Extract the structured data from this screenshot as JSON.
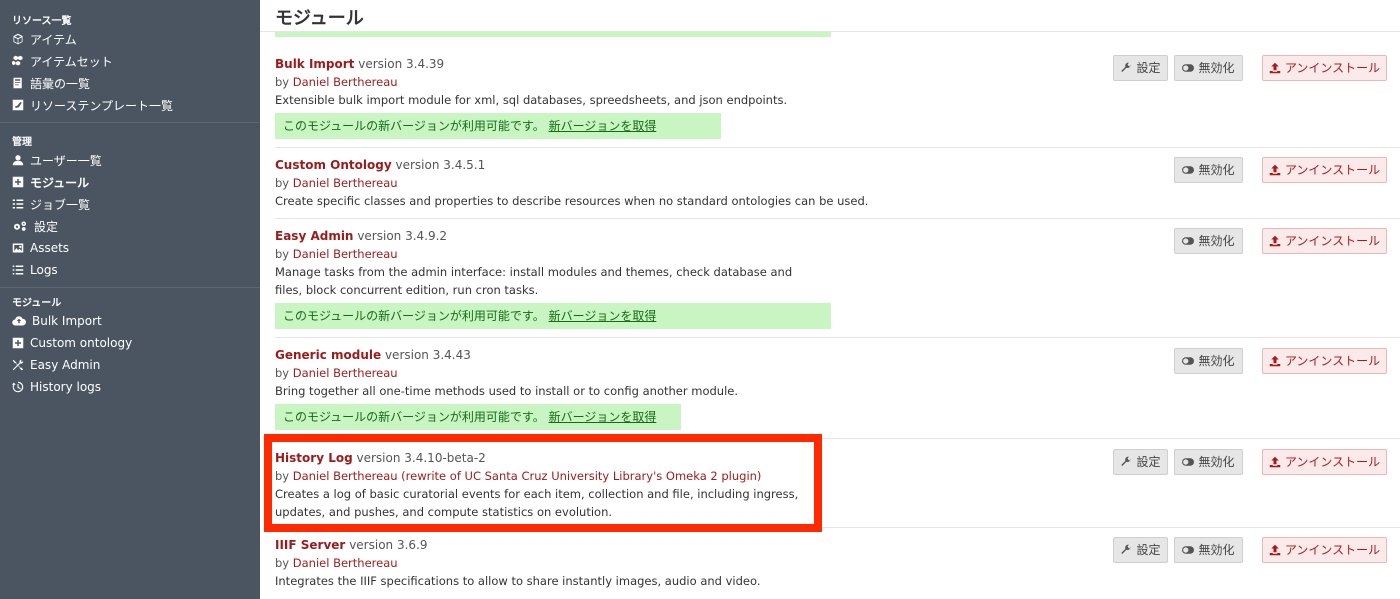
{
  "sidebar": {
    "resources_heading": "リソース一覧",
    "resources": [
      {
        "label": "アイテム",
        "icon": "cube-icon"
      },
      {
        "label": "アイテムセット",
        "icon": "cubes-icon"
      },
      {
        "label": "語彙の一覧",
        "icon": "book-icon"
      },
      {
        "label": "リソーステンプレート一覧",
        "icon": "template-icon"
      }
    ],
    "admin_heading": "管理",
    "admin": [
      {
        "label": "ユーザー一覧",
        "icon": "user-icon"
      },
      {
        "label": "モジュール",
        "icon": "plus-square-icon"
      },
      {
        "label": "ジョブ一覧",
        "icon": "tasks-icon"
      },
      {
        "label": "設定",
        "icon": "cogs-icon"
      },
      {
        "label": "Assets",
        "icon": "image-icon"
      },
      {
        "label": "Logs",
        "icon": "list-icon"
      }
    ],
    "modules_heading": "モジュール",
    "modules": [
      {
        "label": "Bulk Import",
        "icon": "cloud-upload-icon"
      },
      {
        "label": "Custom ontology",
        "icon": "plus-square-icon"
      },
      {
        "label": "Easy Admin",
        "icon": "tools-icon"
      },
      {
        "label": "History logs",
        "icon": "history-icon"
      }
    ]
  },
  "page": {
    "title": "モジュール"
  },
  "labels": {
    "settings": "設定",
    "disable": "無効化",
    "uninstall": "アンインストール",
    "by": "by",
    "update_notice": "このモジュールの新バージョンが利用可能です。",
    "update_link": "新バージョンを取得"
  },
  "modules": [
    {
      "name": "Bulk Import",
      "version": "version 3.4.39",
      "author": "Daniel Berthereau",
      "description": "Extensible bulk import module for xml, sql databases, spreedsheets, and json endpoints.",
      "has_update": true,
      "has_settings": true
    },
    {
      "name": "Custom Ontology",
      "version": "version 3.4.5.1",
      "author": "Daniel Berthereau",
      "description": "Create specific classes and properties to describe resources when no standard ontologies can be used.",
      "has_update": false,
      "has_settings": false
    },
    {
      "name": "Easy Admin",
      "version": "version 3.4.9.2",
      "author": "Daniel Berthereau",
      "description": "Manage tasks from the admin interface: install modules and themes, check database and files, block concurrent edition, run cron tasks.",
      "has_update": true,
      "has_settings": false
    },
    {
      "name": "Generic module",
      "version": "version 3.4.43",
      "author": "Daniel Berthereau",
      "description": "Bring together all one-time methods used to install or to config another module.",
      "has_update": true,
      "has_settings": false
    },
    {
      "name": "History Log",
      "version": "version 3.4.10-beta-2",
      "author": "Daniel Berthereau (rewrite of UC Santa Cruz University Library's Omeka 2 plugin)",
      "description": "Creates a log of basic curatorial events for each item, collection and file, including ingress, updates, and pushes, and compute statistics on evolution.",
      "has_update": false,
      "has_settings": true,
      "highlighted": true
    },
    {
      "name": "IIIF Server",
      "version": "version 3.6.9",
      "author": "Daniel Berthereau",
      "description": "Integrates the IIIF specifications to allow to share instantly images, audio and video.",
      "has_update": false,
      "has_settings": true
    }
  ],
  "colors": {
    "sidebar_bg": "#4b5562",
    "module_name": "#9b1b1b",
    "update_bg": "#c9f5c3",
    "highlight": "#ff2a00"
  }
}
